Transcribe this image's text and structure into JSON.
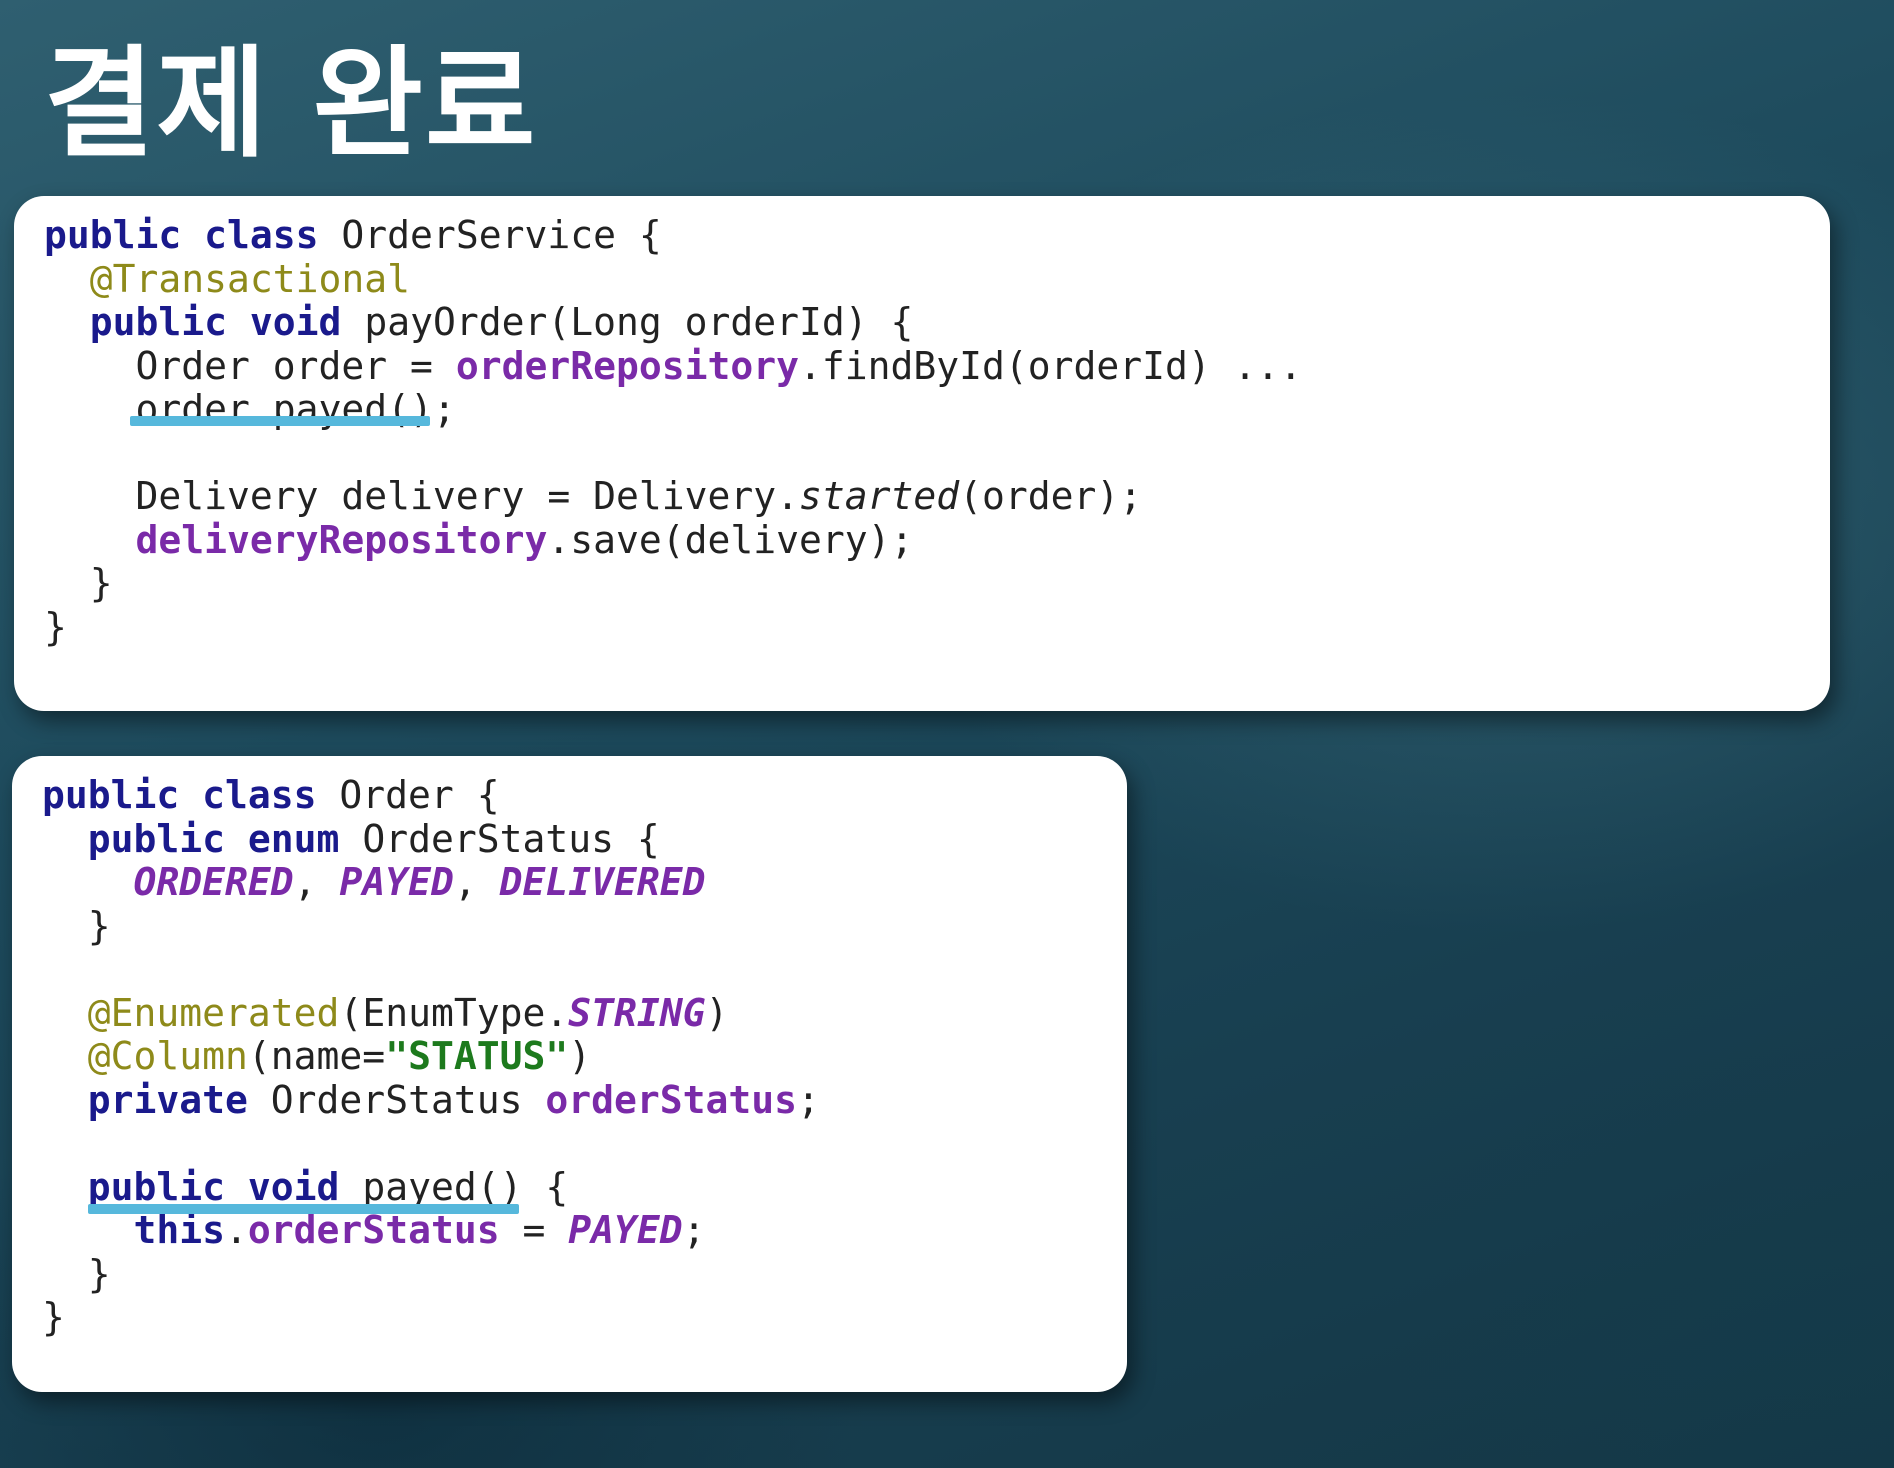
{
  "title": "결제 완료",
  "code_blocks": [
    {
      "lines": [
        [
          {
            "t": "public class",
            "c": "kw"
          },
          {
            "t": " OrderService {"
          }
        ],
        [
          {
            "t": "  "
          },
          {
            "t": "@Transactional",
            "c": "ann"
          }
        ],
        [
          {
            "t": "  "
          },
          {
            "t": "public void",
            "c": "kw"
          },
          {
            "t": " payOrder(Long orderId) {"
          }
        ],
        [
          {
            "t": "    Order order = "
          },
          {
            "t": "orderRepository",
            "c": "fld"
          },
          {
            "t": ".findById(orderId) ..."
          }
        ],
        [
          {
            "t": "    order.payed();"
          }
        ],
        [],
        [
          {
            "t": "    Delivery delivery = Delivery."
          },
          {
            "t": "started",
            "c": "ital"
          },
          {
            "t": "(order);"
          }
        ],
        [
          {
            "t": "    "
          },
          {
            "t": "deliveryRepository",
            "c": "fld"
          },
          {
            "t": ".save(delivery);"
          }
        ],
        [
          {
            "t": "  }"
          }
        ],
        [
          {
            "t": "}"
          }
        ]
      ]
    },
    {
      "lines": [
        [
          {
            "t": "public class",
            "c": "kw"
          },
          {
            "t": " Order {"
          }
        ],
        [
          {
            "t": "  "
          },
          {
            "t": "public enum",
            "c": "kw"
          },
          {
            "t": " OrderStatus {"
          }
        ],
        [
          {
            "t": "    "
          },
          {
            "t": "ORDERED",
            "c": "enumc"
          },
          {
            "t": ", "
          },
          {
            "t": "PAYED",
            "c": "enumc"
          },
          {
            "t": ", "
          },
          {
            "t": "DELIVERED",
            "c": "enumc"
          }
        ],
        [
          {
            "t": "  }"
          }
        ],
        [],
        [
          {
            "t": "  "
          },
          {
            "t": "@Enumerated",
            "c": "ann"
          },
          {
            "t": "(EnumType."
          },
          {
            "t": "STRING",
            "c": "enumc"
          },
          {
            "t": ")"
          }
        ],
        [
          {
            "t": "  "
          },
          {
            "t": "@Column",
            "c": "ann"
          },
          {
            "t": "(name="
          },
          {
            "t": "\"STATUS\"",
            "c": "str"
          },
          {
            "t": ")"
          }
        ],
        [
          {
            "t": "  "
          },
          {
            "t": "private",
            "c": "kw"
          },
          {
            "t": " OrderStatus "
          },
          {
            "t": "orderStatus",
            "c": "fld"
          },
          {
            "t": ";"
          }
        ],
        [],
        [
          {
            "t": "  "
          },
          {
            "t": "public void",
            "c": "kw"
          },
          {
            "t": " payed() {"
          }
        ],
        [
          {
            "t": "    "
          },
          {
            "t": "this",
            "c": "kw"
          },
          {
            "t": "."
          },
          {
            "t": "orderStatus",
            "c": "fld"
          },
          {
            "t": " = "
          },
          {
            "t": "PAYED",
            "c": "enumc"
          },
          {
            "t": ";"
          }
        ],
        [
          {
            "t": "  }"
          }
        ],
        [
          {
            "t": "}"
          }
        ]
      ]
    }
  ],
  "highlight_color": "#56b8dc"
}
